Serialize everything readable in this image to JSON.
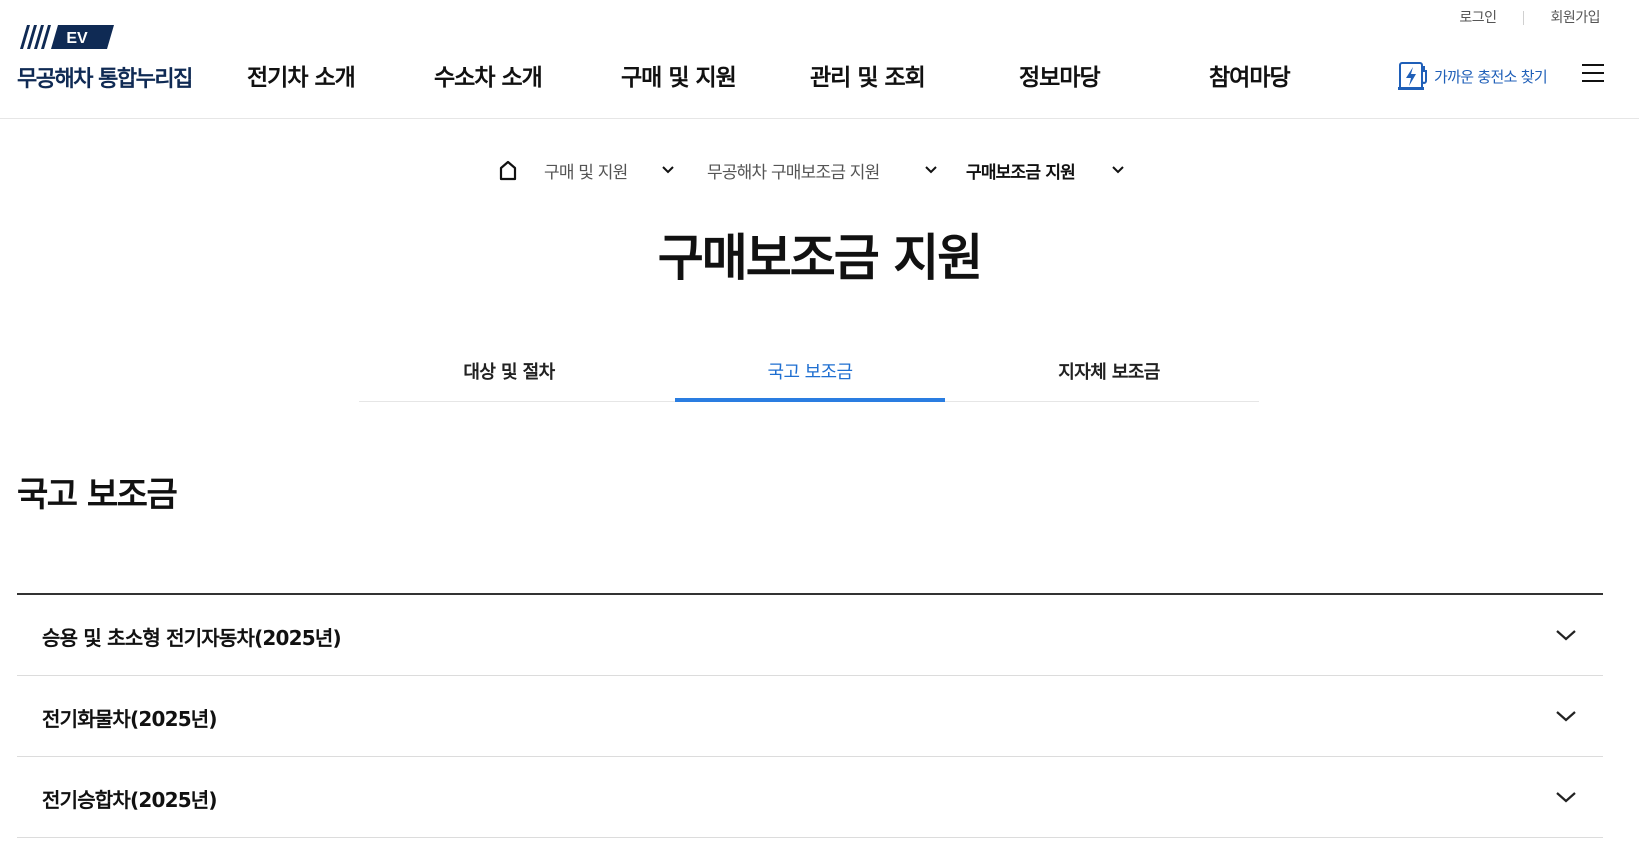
{
  "header": {
    "logo_badge": "EV",
    "logo_text": "무공해차 통합누리집",
    "util_links": [
      "로그인",
      "회원가입"
    ],
    "nav": [
      "전기차 소개",
      "수소차 소개",
      "구매 및 지원",
      "관리 및 조회",
      "정보마당",
      "참여마당"
    ],
    "charger_label": "가까운 충전소 찾기",
    "icons": {
      "charger": "ev-charger-icon",
      "menu": "hamburger-menu-icon",
      "home": "home-icon",
      "chevron": "chevron-down-icon"
    }
  },
  "breadcrumb": {
    "items": [
      "구매 및 지원",
      "무공해차 구매보조금 지원",
      "구매보조금 지원"
    ]
  },
  "page_title": "구매보조금 지원",
  "tabs": {
    "items": [
      "대상 및 절차",
      "국고 보조금",
      "지자체 보조금"
    ],
    "active": "국고 보조금"
  },
  "section_title": "국고 보조금",
  "accordion": {
    "items": [
      "승용 및 초소형 전기자동차(2025년)",
      "전기화물차(2025년)",
      "전기승합차(2025년)"
    ]
  },
  "colors": {
    "brand_navy": "#0f2a54",
    "accent_blue": "#2a7de1",
    "active_tab_text": "#1f6fd1",
    "charger_blue": "#1f5fb8"
  }
}
